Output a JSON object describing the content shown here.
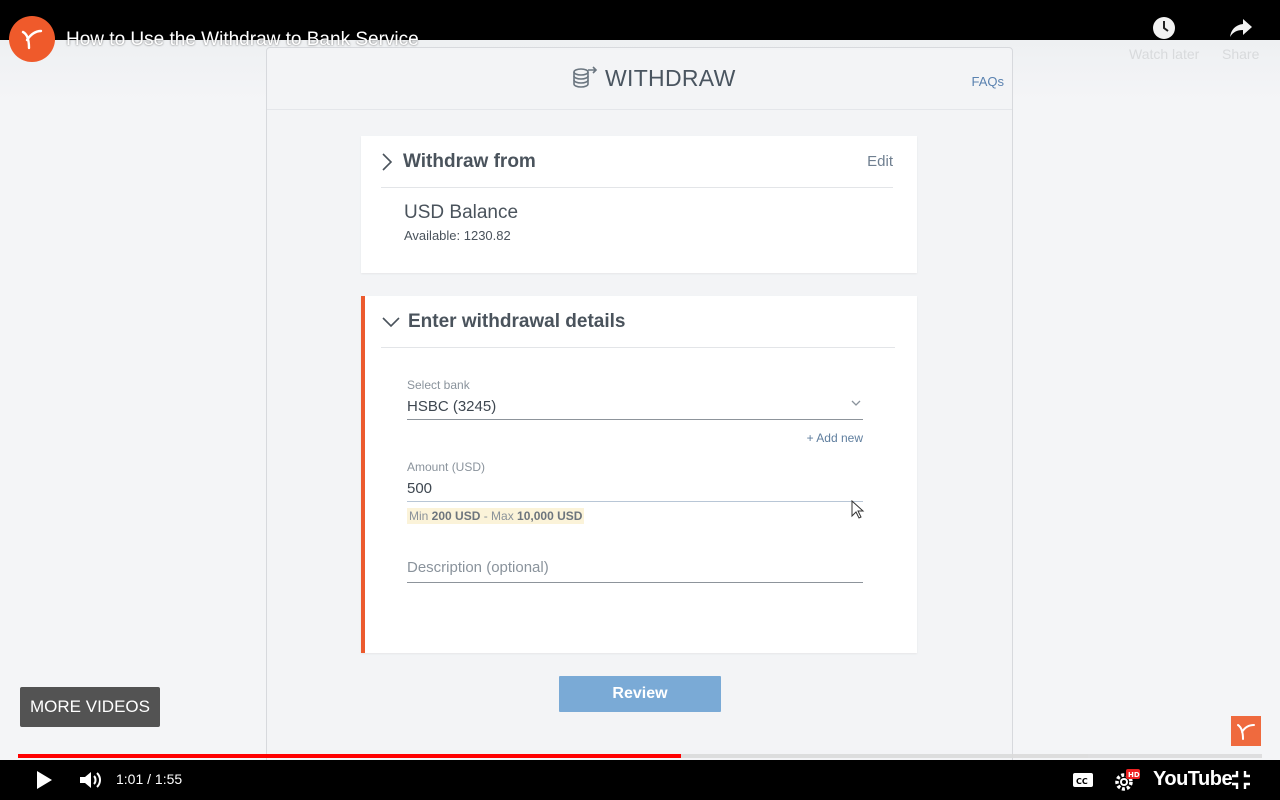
{
  "video": {
    "title": "How to Use the Withdraw to Bank Service",
    "watch_later": "Watch later",
    "share": "Share",
    "more_videos": "MORE VIDEOS",
    "time": "1:01 / 1:55",
    "progress": 0.533,
    "buffered": 0.86,
    "youtube_label": "YouTube",
    "hd_badge": "HD"
  },
  "app": {
    "title": "WITHDRAW",
    "faqs": "FAQs",
    "withdraw_from": {
      "title": "Withdraw from",
      "edit": "Edit",
      "balance_title": "USD Balance",
      "available": "Available: 1230.82"
    },
    "details": {
      "title": "Enter withdrawal details",
      "bank_label": "Select bank",
      "bank_value": "HSBC (3245)",
      "add_new": "+ Add new",
      "amount_label": "Amount (USD)",
      "amount_value": "500",
      "hint_min_prefix": "Min ",
      "hint_min": "200 USD",
      "hint_sep": " - Max ",
      "hint_max": "10,000 USD",
      "description_placeholder": "Description (optional)"
    },
    "review_button": "Review"
  },
  "colors": {
    "accent": "#ec5a2e",
    "button": "#7aaad6",
    "progress": "#ff0000",
    "link": "#5a82b0"
  }
}
